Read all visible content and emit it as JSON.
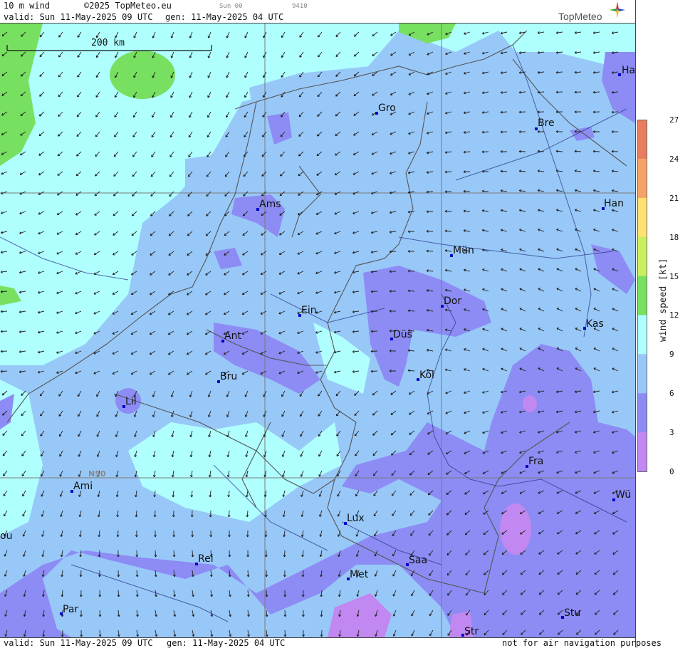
{
  "header": {
    "product": "10 m wind",
    "copyright": "©2025 TopMeteo.eu",
    "valid": "valid:  Sun  11-May-2025  09 UTC",
    "gen": "gen: 11-May-2025 04 UTC",
    "small1": "Sun 00",
    "small2": "9410",
    "logo": "TopMeteo"
  },
  "footer": {
    "valid": "valid:  Sun  11-May-2025  09 UTC",
    "gen": "gen: 11-May-2025 04 UTC",
    "disclaimer": "not for air navigation purposes"
  },
  "scale": {
    "label": "200 km"
  },
  "grid_label": "N50",
  "cities": [
    "Ha",
    "Gro",
    "Bre",
    "Ams",
    "Han",
    "Mün",
    "Ein",
    "Dor",
    "Kas",
    "Düs",
    "Ant",
    "Köl",
    "Bru",
    "Lil",
    "Fra",
    "Ami",
    "Wü",
    "Lux",
    "ou",
    "Rei",
    "Saa",
    "Met",
    "Par",
    "Stu",
    "Str"
  ],
  "legend": {
    "title": "wind  speed  [kt]",
    "ticks": [
      "27",
      "24",
      "21",
      "18",
      "15",
      "12",
      "9",
      "6",
      "3",
      "0"
    ],
    "colors": [
      "#e87e60",
      "#f4a268",
      "#ffe070",
      "#c8ef60",
      "#78e060",
      "#b0ffff",
      "#98c8f8",
      "#8c8cf4",
      "#c088f0"
    ]
  }
}
